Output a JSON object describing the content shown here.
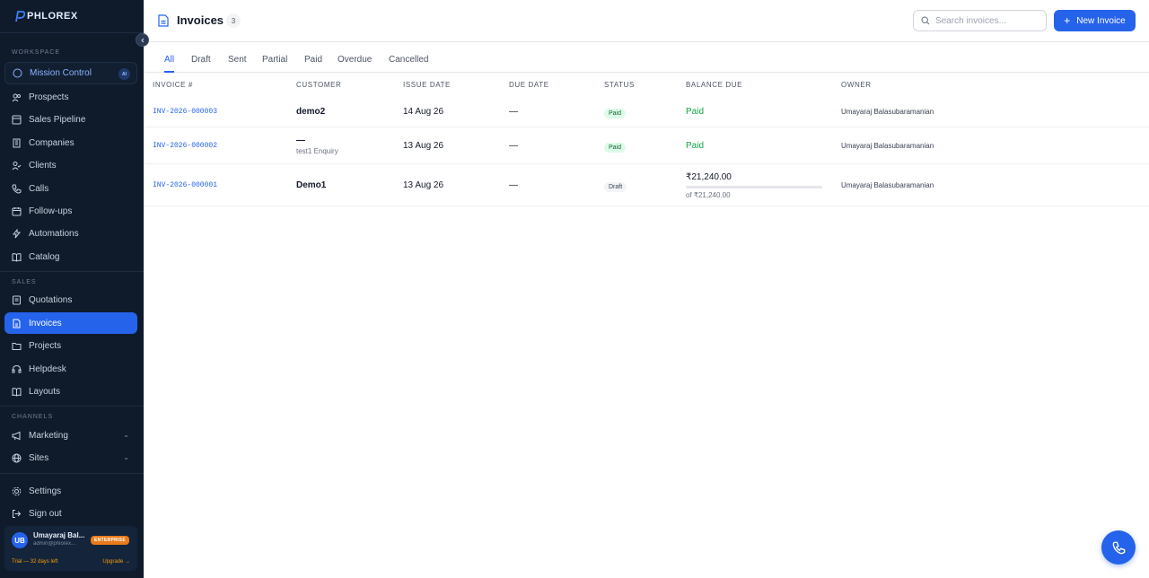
{
  "sidebar": {
    "logo_text": "PHLOREX",
    "sections": {
      "workspace": "WORKSPACE",
      "sales": "SALES",
      "channels": "CHANNELS"
    },
    "mission": {
      "label": "Mission Control",
      "badge": "AI"
    },
    "workspace_items": [
      "Prospects",
      "Sales Pipeline",
      "Companies",
      "Clients",
      "Calls",
      "Follow-ups",
      "Automations",
      "Catalog"
    ],
    "sales_items": [
      "Quotations",
      "Invoices",
      "Projects",
      "Helpdesk",
      "Layouts"
    ],
    "channel_items": [
      "Marketing",
      "Sites"
    ],
    "bottom_items": [
      "Settings",
      "Sign out"
    ],
    "user": {
      "initials": "UB",
      "name": "Umayaraj Bal...",
      "email": "admin@phlorex...",
      "plan": "ENTERPRISE",
      "trial": "Trial — 32 days left",
      "upgrade": "Upgrade →"
    }
  },
  "header": {
    "title": "Invoices",
    "count": "3",
    "search_placeholder": "Search invoices...",
    "new_button": "New Invoice"
  },
  "tabs": [
    "All",
    "Draft",
    "Sent",
    "Partial",
    "Paid",
    "Overdue",
    "Cancelled"
  ],
  "table": {
    "columns": [
      "INVOICE #",
      "CUSTOMER",
      "ISSUE DATE",
      "DUE DATE",
      "STATUS",
      "BALANCE DUE",
      "OWNER"
    ],
    "rows": [
      {
        "number": "INV-2026-000003",
        "customer": "demo2",
        "customer_sub": "",
        "issue_date": "14 Aug 26",
        "due_date": "—",
        "status": "Paid",
        "balance": "Paid",
        "balance_sub": "",
        "paid_fraction": 1,
        "owner": "Umayaraj Balasubaramanian"
      },
      {
        "number": "INV-2026-000002",
        "customer": "—",
        "customer_sub": "test1 Enquiry",
        "issue_date": "13 Aug 26",
        "due_date": "—",
        "status": "Paid",
        "balance": "Paid",
        "balance_sub": "",
        "paid_fraction": 1,
        "owner": "Umayaraj Balasubaramanian"
      },
      {
        "number": "INV-2026-000001",
        "customer": "Demo1",
        "customer_sub": "",
        "issue_date": "13 Aug 26",
        "due_date": "—",
        "status": "Draft",
        "balance": "₹21,240.00",
        "balance_sub": "of ₹21,240.00",
        "paid_fraction": 0,
        "owner": "Umayaraj Balasubaramanian"
      }
    ]
  },
  "colors": {
    "accent": "#2563eb",
    "sidebar_bg": "#0f1b2b",
    "paid_green": "#16a34a"
  }
}
